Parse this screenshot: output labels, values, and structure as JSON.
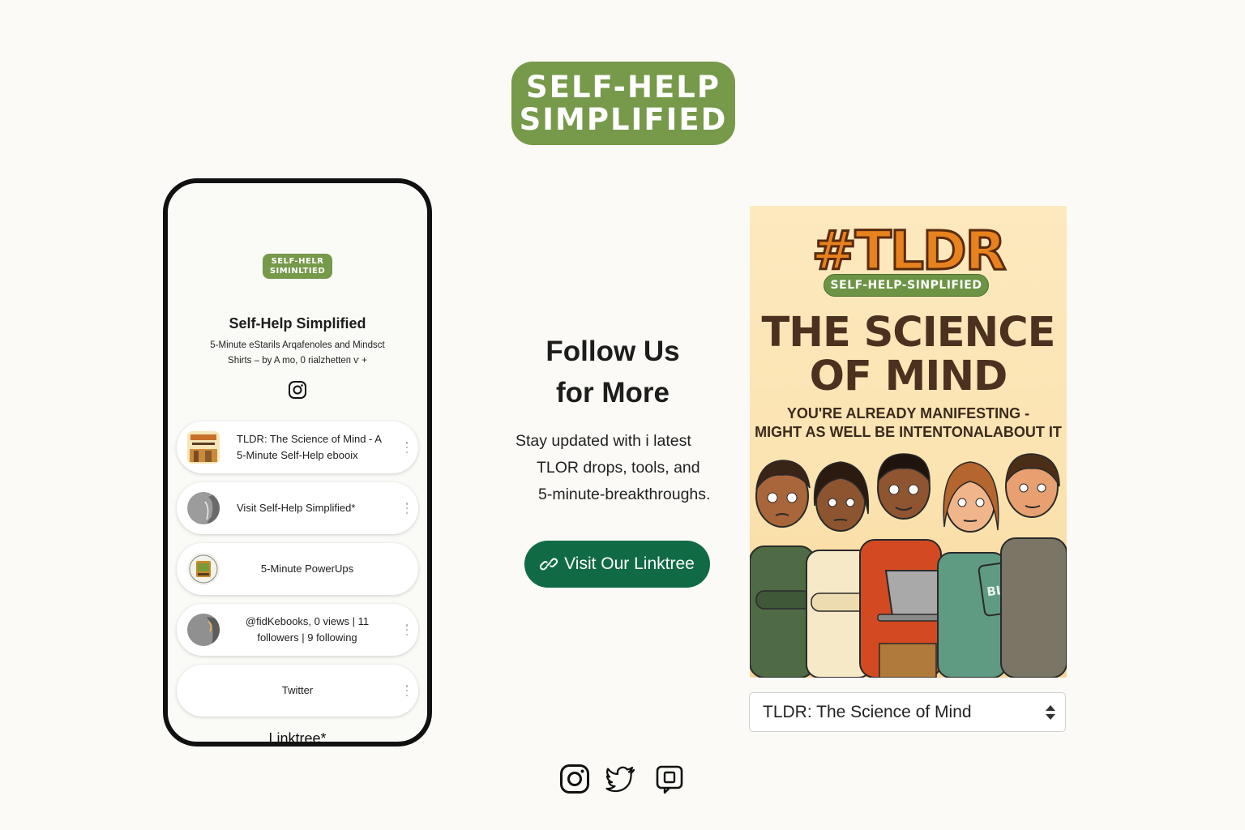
{
  "brand": {
    "logo_line1": "SELF-HELP",
    "logo_line2": "SIMPLIFIED",
    "accent_color": "#76994a",
    "cta_color": "#106b45"
  },
  "phone": {
    "mini_logo_line1": "SELF-HELR",
    "mini_logo_line2": "SIMINLTIED",
    "profile_name": "Self-Help Simplified",
    "bio_line1": "5-Minute eStarils Arqafenoles and Mindsct",
    "bio_line2": "Shirts – by A mo, 0 rialzhetteп ⱱ +",
    "profile_icon": "instagram-icon",
    "links": [
      {
        "line1": "TLDR: The Science of Mind - A",
        "line2": "5-Minute Self-Help ebooix"
      },
      {
        "line1": "Visit Self-Help Simplified*",
        "line2": ""
      },
      {
        "line1": "5-Minute PowerUps",
        "line2": ""
      },
      {
        "line1": "@fidKebooks, 0 views | 11",
        "line2": "followers | 9 following"
      },
      {
        "line1": "Twitter",
        "line2": ""
      }
    ],
    "footer": "Linktree*"
  },
  "follow": {
    "title_line1": "Follow Us",
    "title_line2": "for More",
    "sub_line1": "Stay updated with i latest",
    "sub_line2": "TLOR drops, tools, and",
    "sub_line3": "5-minute-breakthroughs.",
    "cta_label": "Visit Our Linktree",
    "cta_icon": "link-icon"
  },
  "poster": {
    "hashtag": "#TLDR",
    "badge": "SELF-HELP-SINPLIFIED",
    "title_line1": "THE SCIENCE",
    "title_line2": "OF MIND",
    "tagline_line1": "YOU'RE ALREADY MANIFESTING -",
    "tagline_line2": "MIGHT AS WELL BE INTENTONALABOUT IT",
    "tablet_text": "BLHMN"
  },
  "book_select": {
    "selected": "TLDR: The Science of Mind"
  },
  "social": [
    "instagram-icon",
    "twitter-icon",
    "linktree-icon"
  ]
}
